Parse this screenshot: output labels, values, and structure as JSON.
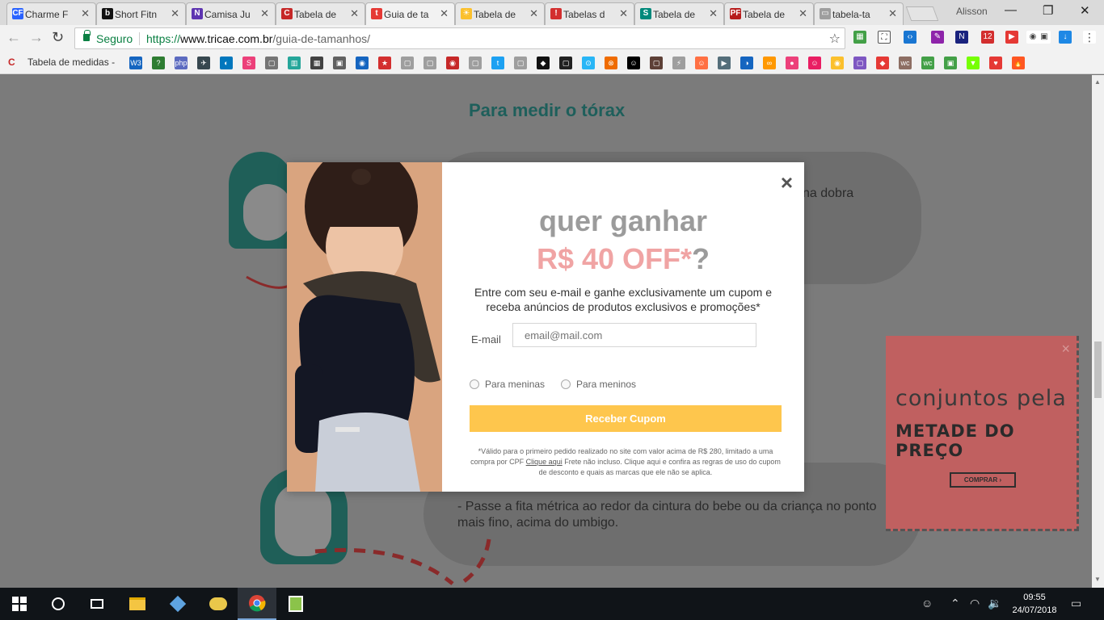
{
  "browser": {
    "tabs": [
      {
        "title": "Charme F",
        "fav_text": "CF",
        "fav_color": "#2962ff"
      },
      {
        "title": "Short Fitn",
        "fav_text": "b",
        "fav_color": "#111111"
      },
      {
        "title": "Camisa Ju",
        "fav_text": "N",
        "fav_color": "#5e35b1"
      },
      {
        "title": "Tabela de",
        "fav_text": "C",
        "fav_color": "#c62828"
      },
      {
        "title": "Guia de ta",
        "fav_text": "t",
        "fav_color": "#e53935"
      },
      {
        "title": "Tabela de",
        "fav_text": "☀",
        "fav_color": "#fbc02d"
      },
      {
        "title": "Tabelas d",
        "fav_text": "!",
        "fav_color": "#d32f2f"
      },
      {
        "title": "Tabela de",
        "fav_text": "S",
        "fav_color": "#00897b"
      },
      {
        "title": "Tabela de",
        "fav_text": "PF",
        "fav_color": "#b71c1c"
      },
      {
        "title": "tabela-ta",
        "fav_text": "▭",
        "fav_color": "#9e9e9e"
      }
    ],
    "active_tab_index": 4,
    "profile_name": "Alisson",
    "security_label": "Seguro",
    "url_scheme": "https://",
    "url_host": "www.tricae.com.br",
    "url_path": "/guia-de-tamanhos/",
    "extension_badge": "12",
    "bookmarks": {
      "first_label": "Tabela de medidas -",
      "icons": [
        "W3",
        "?",
        "php",
        "✈",
        "◐",
        "S",
        "▢",
        "▥",
        "▦",
        "▣",
        "◉",
        "★",
        "▢",
        "▢",
        "◉",
        "▢",
        "t",
        "▢",
        "◆",
        "▢",
        "⊙",
        "⊗",
        "☺",
        "▢",
        "⚡",
        "☺",
        "▶",
        "◑",
        "∞",
        "●",
        "☺",
        "◉",
        "▢",
        "◆",
        "wc",
        "wc",
        "▣",
        "▼",
        "♥",
        "🔥"
      ],
      "icon_colors": [
        "#1565c0",
        "#2e7d32",
        "#5c6bc0",
        "#37474f",
        "#0277bd",
        "#ec407a",
        "#757575",
        "#26a69a",
        "#424242",
        "#616161",
        "#1565c0",
        "#d32f2f",
        "#9e9e9e",
        "#9e9e9e",
        "#c62828",
        "#9e9e9e",
        "#1da1f2",
        "#9e9e9e",
        "#111111",
        "#212121",
        "#29b6f6",
        "#ef6c00",
        "#000000",
        "#5d4037",
        "#9e9e9e",
        "#ff7043",
        "#546e7a",
        "#1565c0",
        "#ff9800",
        "#ec407a",
        "#e91e63",
        "#fbc02d",
        "#7e57c2",
        "#e53935",
        "#8d6e63",
        "#43a047",
        "#43a047",
        "#76ff03",
        "#e53935",
        "#ff5722"
      ]
    }
  },
  "page": {
    "heading": "Para medir o tórax",
    "text_top": "na dobra",
    "text_bottom": "- Passe a fita métrica ao redor da cintura do bebe ou da criança no ponto mais fino, acima do umbigo."
  },
  "modal": {
    "close_symbol": "×",
    "title_line1": "quer ganhar",
    "title_amount": "R$ 40 OFF",
    "title_asterisk": "*",
    "title_question": "?",
    "description": "Entre com seu e-mail e ganhe exclusivamente um cupom e receba anúncios de produtos exclusivos e promoções*",
    "email_label": "E-mail",
    "email_placeholder": "email@mail.com",
    "radio_girls": "Para meninas",
    "radio_boys": "Para meninos",
    "submit_label": "Receber Cupom",
    "fine_print_1": "*Válido para o primeiro pedido realizado no site com valor acima de R$ 280, limitado a uma compra por CPF",
    "fine_print_link": "Clique aqui",
    "fine_print_2": "Frete não incluso. Clique aqui e confira as regras de uso do cupom de desconto e quais as marcas que ele não se aplica.",
    "colors": {
      "amount": "#f0a4a4",
      "title": "#9b9b9b",
      "button": "#fec64d"
    }
  },
  "ad": {
    "close_symbol": "×",
    "line1": "conjuntos pela",
    "line2": "METADE DO PREÇO",
    "button": "COMPRAR ›",
    "background": "#c06060"
  },
  "taskbar": {
    "time": "09:55",
    "date": "24/07/2018",
    "items": [
      "windows-start",
      "cortana",
      "task-view",
      "file-explorer",
      "3d-viewer",
      "app-yellow",
      "chrome",
      "sublime"
    ]
  }
}
